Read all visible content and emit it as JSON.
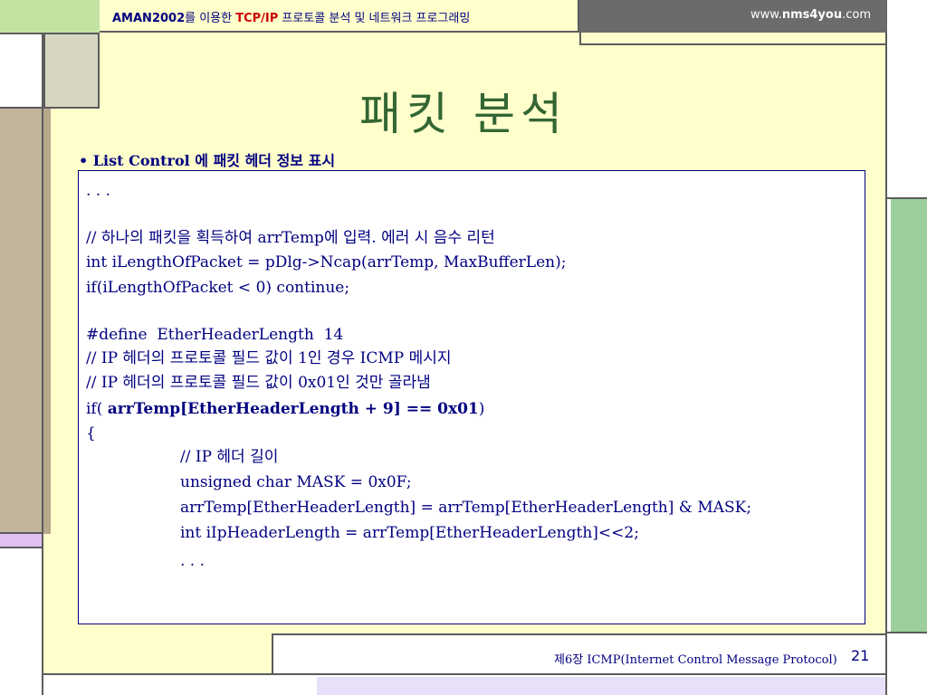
{
  "header": {
    "app_name": "AMAN2002",
    "subtitle_part1": "를 이용한 ",
    "protocol": "TCP/IP",
    "subtitle_part2": " 프로토콜 분석 및 네트워크 프로그래밍",
    "website_prefix": "www.",
    "website_domain": "nms4you",
    "website_suffix": ".com"
  },
  "slide": {
    "title": "패킷 분석",
    "bullet": "• List Control 에 패킷 헤더 정보 표시"
  },
  "code": {
    "line1": ". . .",
    "line2": "// 하나의 패킷을 획득하여 arrTemp에 입력. 에러 시 음수 리턴",
    "line3": "int iLengthOfPacket = pDlg->Ncap(arrTemp, MaxBufferLen);",
    "line4": "if(iLengthOfPacket < 0) continue;",
    "line5": "#define  EtherHeaderLength  14",
    "line6": "// IP 헤더의 프로토콜 필드 값이 1인 경우 ICMP 메시지",
    "line7": "// IP 헤더의 프로토콜 필드 값이 0x01인 것만 골라냄",
    "line8_prefix": "if( ",
    "line8_bold": "arrTemp[EtherHeaderLength + 9] == 0x01",
    "line8_suffix": ")",
    "line9": "{",
    "line10": "// IP 헤더 길이",
    "line11": "unsigned char MASK = 0x0F;",
    "line12": "arrTemp[EtherHeaderLength] = arrTemp[EtherHeaderLength] & MASK;",
    "line13": "int iIpHeaderLength = arrTemp[EtherHeaderLength]<<2;",
    "line14": ". . ."
  },
  "footer": {
    "chapter": "제6장  ICMP(Internet Control Message Protocol)",
    "page": "21"
  },
  "colors": {
    "accent_navy": "#000080",
    "title_green": "#336633",
    "background_yellow": "#ffffcc",
    "green_block": "#c2e3a1",
    "tan_block": "#c2b59b",
    "right_green": "#9ccf9c"
  }
}
